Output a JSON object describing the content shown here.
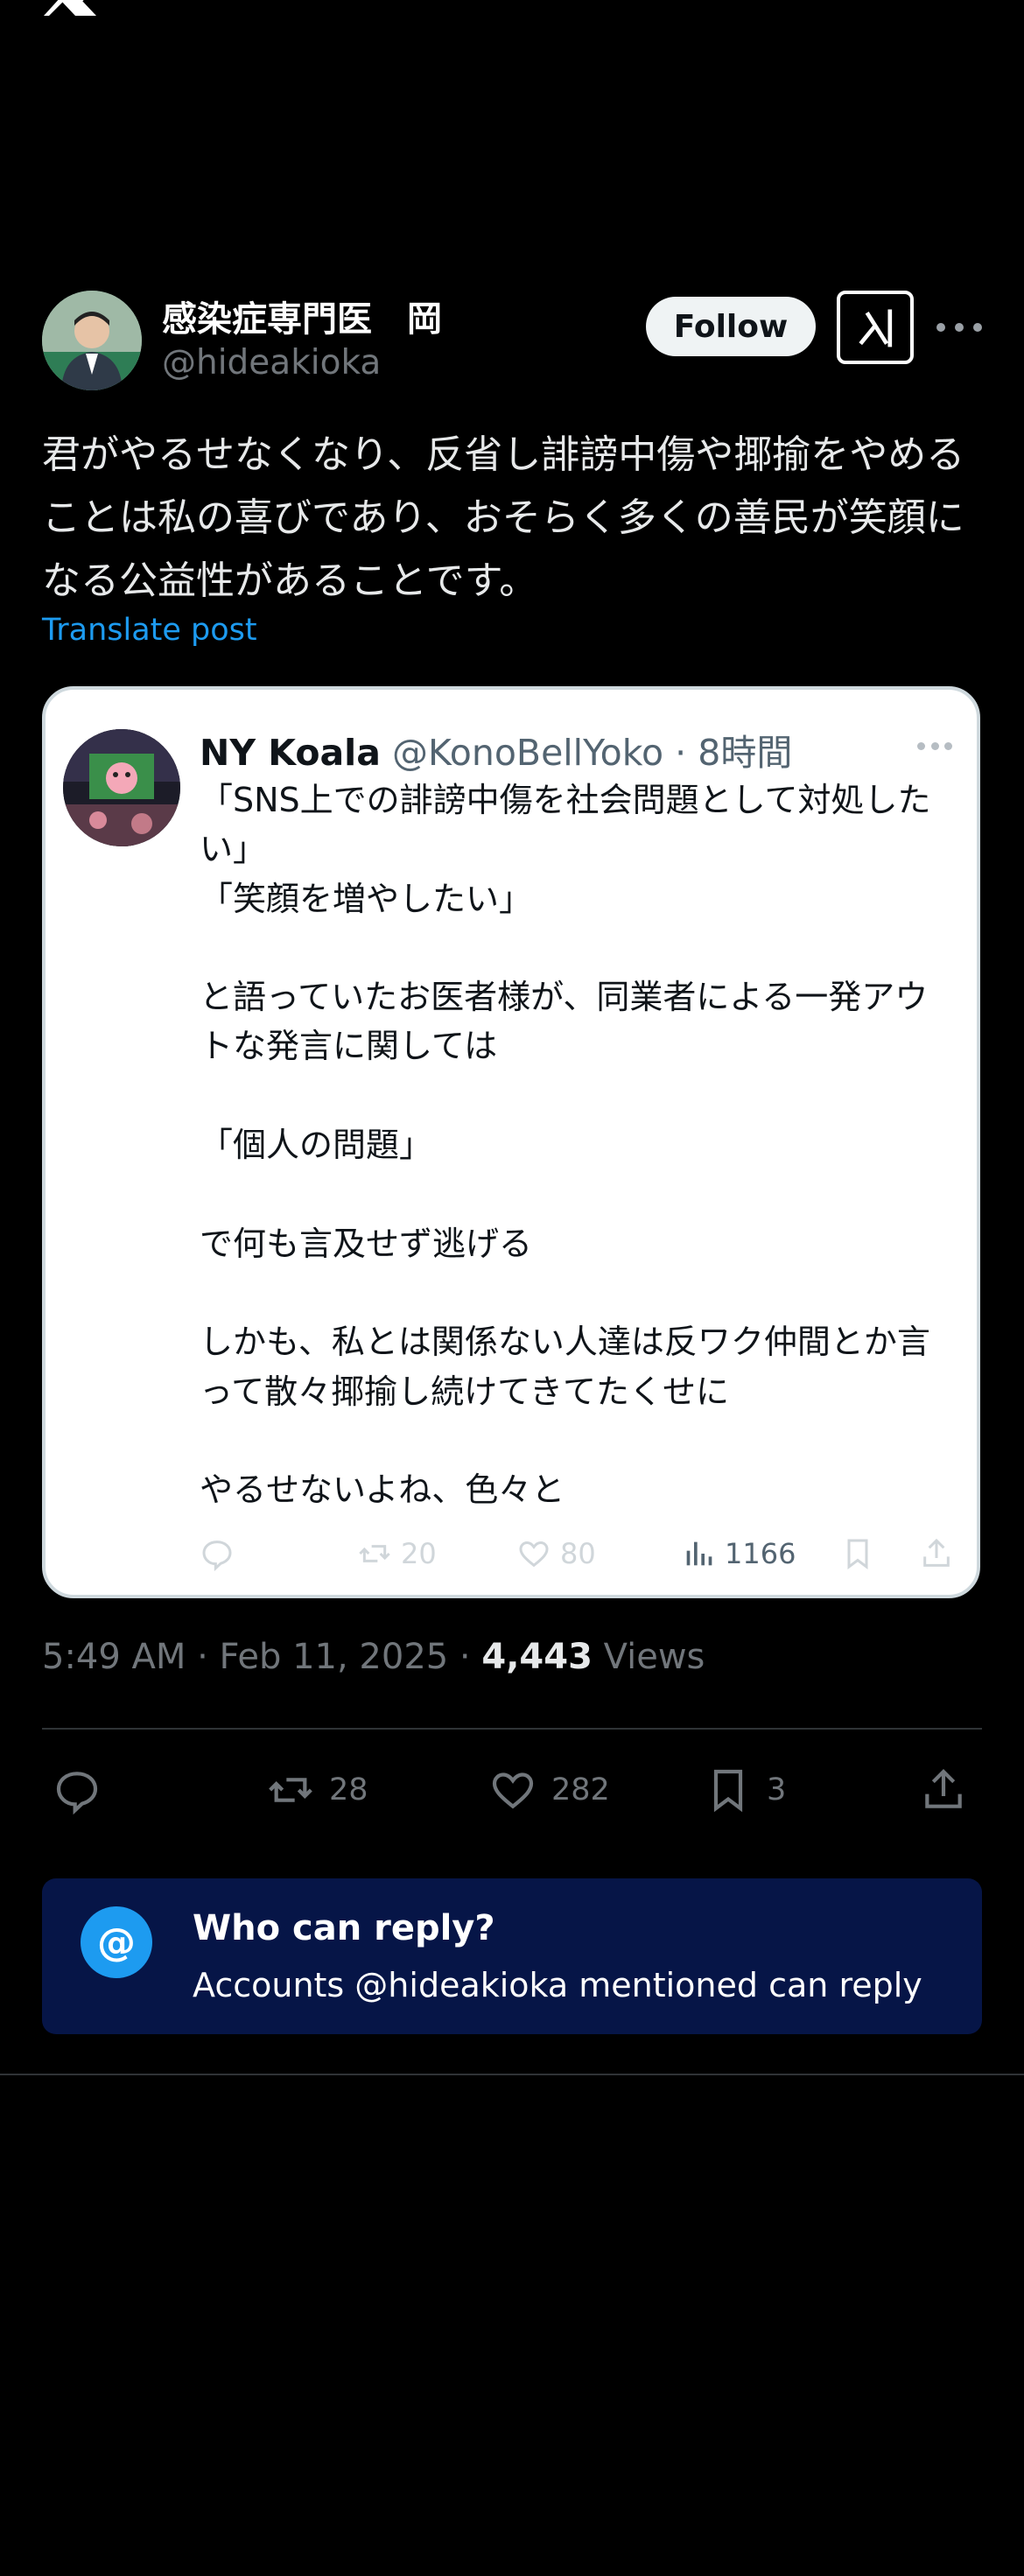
{
  "header": {
    "logo_icon": "x-logo-icon"
  },
  "author": {
    "name": "感染症専門医　岡",
    "handle": "@hideakioka",
    "follow_label": "Follow",
    "grok_icon": "grok-icon",
    "more_icon": "more-horizontal-icon"
  },
  "tweet": {
    "text": "君がやるせなくなり、反省し誹謗中傷や揶揄をやめることは私の喜びであり、おそらく多くの善民が笑顔になる公益性があることです。",
    "translate_label": "Translate post"
  },
  "quote": {
    "name": "NY Koala",
    "handle": "@KonoBellYoko",
    "separator": "·",
    "time": "8時間",
    "body": "「SNS上での誹謗中傷を社会問題として対処したい」\n「笑顔を増やしたい」\n\nと語っていたお医者様が、同業者による一発アウトな発言に関しては\n\n「個人の問題」\n\nで何も言及せず逃げる\n\nしかも、私とは関係ない人達は反ワク仲間とか言って散々揶揄し続けてきてたくせに\n\nやるせないよね、色々と",
    "retweets": "20",
    "likes": "80",
    "views": "1166"
  },
  "meta": {
    "time": "5:49 AM · Feb 11, 2025 · ",
    "views_count": "4,443",
    "views_label": " Views"
  },
  "actions": {
    "reply_count": "",
    "retweet_count": "28",
    "like_count": "282",
    "bookmark_count": "3"
  },
  "reply_restriction": {
    "icon": "@",
    "title": "Who can reply?",
    "subtitle": "Accounts @hideakioka mentioned can reply"
  },
  "colors": {
    "accent": "#1d9bf0",
    "reply_box_bg": "#061547",
    "muted": "#71767b"
  }
}
